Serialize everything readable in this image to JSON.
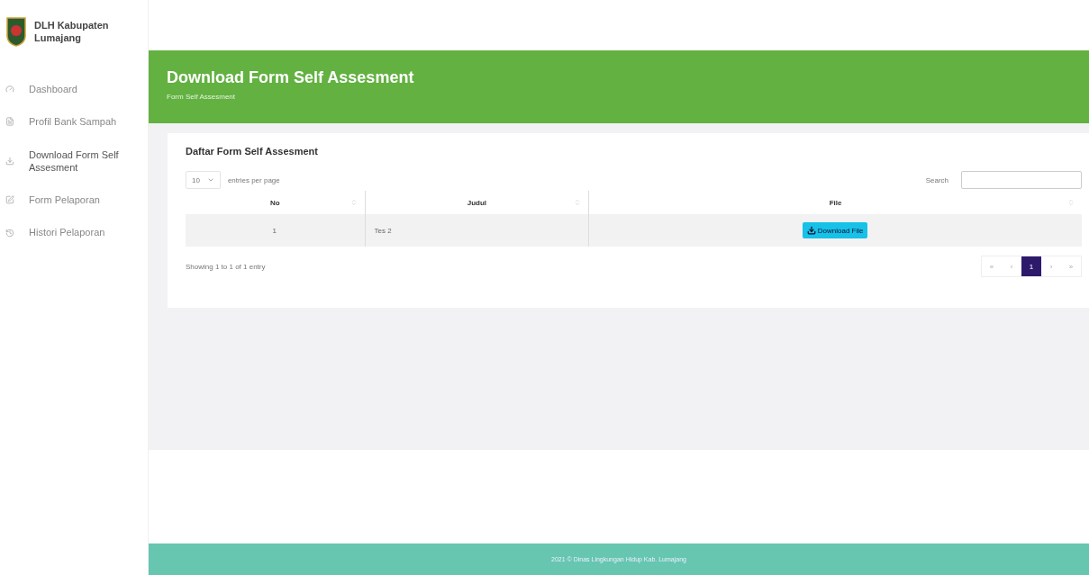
{
  "brand": {
    "name": "DLH Kabupaten Lumajang"
  },
  "sidebar": {
    "items": [
      {
        "label": "Dashboard",
        "kind": "dashboard",
        "selected": false
      },
      {
        "label": "Profil Bank Sampah",
        "kind": "profile",
        "selected": false
      },
      {
        "label": "Download Form Self Assesment",
        "kind": "download",
        "selected": true
      },
      {
        "label": "Form Pelaporan",
        "kind": "edit",
        "selected": false
      },
      {
        "label": "Histori Pelaporan",
        "kind": "history",
        "selected": false
      }
    ]
  },
  "header": {
    "title": "Download Form Self Assesment",
    "breadcrumb": "Form Self Assesment"
  },
  "card": {
    "title": "Daftar Form Self Assesment",
    "page_size": "10",
    "page_size_label": "entries per page",
    "search_label": "Search",
    "table": {
      "columns": [
        "No",
        "Judul",
        "File"
      ],
      "rows": [
        {
          "no": "1",
          "judul": "Tes 2",
          "action": "Download File"
        }
      ]
    },
    "info": "Showing 1 to 1 of 1 entry",
    "pagination": [
      {
        "label": "«",
        "selected": false
      },
      {
        "label": "‹",
        "selected": false
      },
      {
        "label": "1",
        "selected": true
      },
      {
        "label": "›",
        "selected": false
      },
      {
        "label": "»",
        "selected": false
      }
    ]
  },
  "footer": {
    "text": "2021 © Dinas Lingkungan Hidup Kab. Lumajang"
  }
}
